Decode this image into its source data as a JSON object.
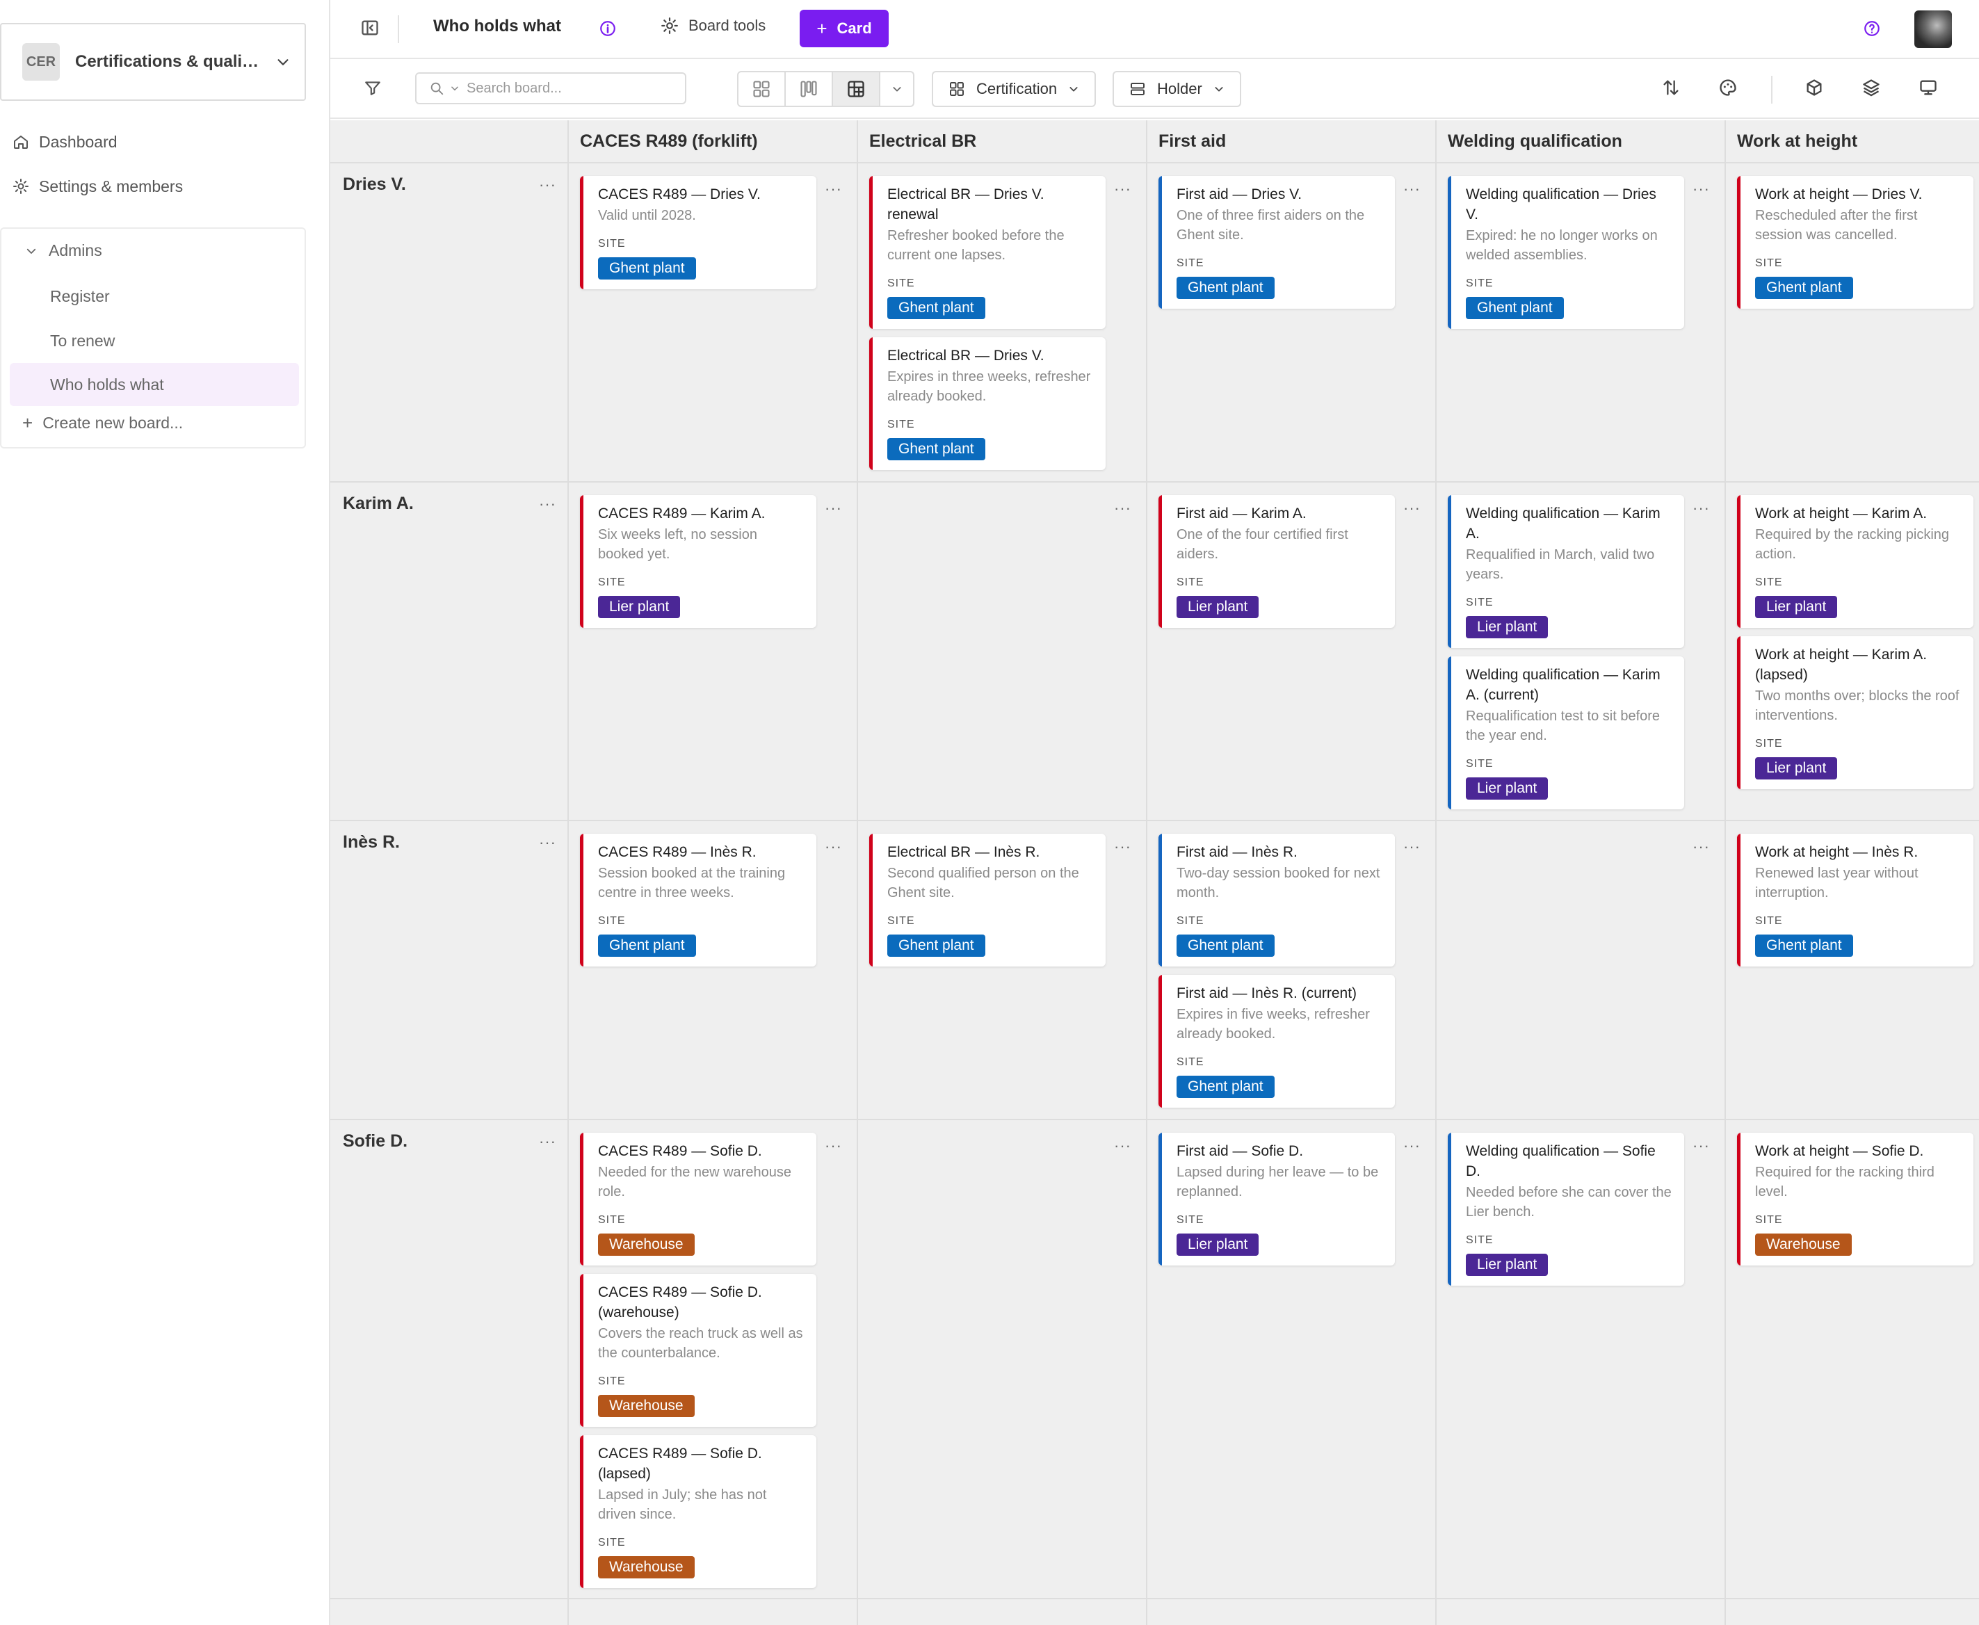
{
  "colors": {
    "red": "#d0021b",
    "blue": "#1565c0",
    "ghent": "#0b6bbd",
    "lier": "#4b2796",
    "warehouse": "#b5561a",
    "primary": "#7a1df0"
  },
  "sidebar": {
    "workspace_badge": "CER",
    "workspace_name": "Certifications & qualifications",
    "dashboard": "Dashboard",
    "settings": "Settings & members",
    "group_label": "Admins",
    "boards": [
      "Register",
      "To renew",
      "Who holds what"
    ],
    "create": "Create new board..."
  },
  "topbar": {
    "title": "Who holds what",
    "tools": "Board tools",
    "card_button": "Card"
  },
  "toolbar": {
    "search_placeholder": "Search board...",
    "group_by": "Certification",
    "row_by": "Holder"
  },
  "board": {
    "columns": [
      "CACES R489 (forklift)",
      "Electrical BR",
      "First aid",
      "Welding qualification",
      "Work at height"
    ],
    "site_label": "SITE",
    "rows": [
      {
        "name": "Dries V.",
        "cells": [
          [
            {
              "title": "CACES R489 — Dries V.",
              "desc": "Valid until 2028.",
              "site": "Ghent plant",
              "accent": "red"
            }
          ],
          [
            {
              "title": "Electrical BR — Dries V. renewal",
              "desc": "Refresher booked before the current one lapses.",
              "site": "Ghent plant",
              "accent": "red"
            },
            {
              "title": "Electrical BR — Dries V.",
              "desc": "Expires in three weeks, refresher already booked.",
              "site": "Ghent plant",
              "accent": "red"
            }
          ],
          [
            {
              "title": "First aid — Dries V.",
              "desc": "One of three first aiders on the Ghent site.",
              "site": "Ghent plant",
              "accent": "blue"
            }
          ],
          [
            {
              "title": "Welding qualification — Dries V.",
              "desc": "Expired: he no longer works on welded assemblies.",
              "site": "Ghent plant",
              "accent": "blue"
            }
          ],
          [
            {
              "title": "Work at height — Dries V.",
              "desc": "Rescheduled after the first session was cancelled.",
              "site": "Ghent plant",
              "accent": "red"
            }
          ]
        ]
      },
      {
        "name": "Karim A.",
        "cells": [
          [
            {
              "title": "CACES R489 — Karim A.",
              "desc": "Six weeks left, no session booked yet.",
              "site": "Lier plant",
              "accent": "red"
            }
          ],
          [],
          [
            {
              "title": "First aid — Karim A.",
              "desc": "One of the four certified first aiders.",
              "site": "Lier plant",
              "accent": "red"
            }
          ],
          [
            {
              "title": "Welding qualification — Karim A.",
              "desc": "Requalified in March, valid two years.",
              "site": "Lier plant",
              "accent": "blue"
            },
            {
              "title": "Welding qualification — Karim A. (current)",
              "desc": "Requalification test to sit before the year end.",
              "site": "Lier plant",
              "accent": "blue"
            }
          ],
          [
            {
              "title": "Work at height — Karim A.",
              "desc": "Required by the racking picking action.",
              "site": "Lier plant",
              "accent": "red"
            },
            {
              "title": "Work at height — Karim A. (lapsed)",
              "desc": "Two months over; blocks the roof interventions.",
              "site": "Lier plant",
              "accent": "red"
            }
          ]
        ]
      },
      {
        "name": "Inès R.",
        "cells": [
          [
            {
              "title": "CACES R489 — Inès R.",
              "desc": "Session booked at the training centre in three weeks.",
              "site": "Ghent plant",
              "accent": "red"
            }
          ],
          [
            {
              "title": "Electrical BR — Inès R.",
              "desc": "Second qualified person on the Ghent site.",
              "site": "Ghent plant",
              "accent": "red"
            }
          ],
          [
            {
              "title": "First aid — Inès R.",
              "desc": "Two-day session booked for next month.",
              "site": "Ghent plant",
              "accent": "blue"
            },
            {
              "title": "First aid — Inès R. (current)",
              "desc": "Expires in five weeks, refresher already booked.",
              "site": "Ghent plant",
              "accent": "red"
            }
          ],
          [],
          [
            {
              "title": "Work at height — Inès R.",
              "desc": "Renewed last year without interruption.",
              "site": "Ghent plant",
              "accent": "red"
            }
          ]
        ]
      },
      {
        "name": "Sofie D.",
        "cells": [
          [
            {
              "title": "CACES R489 — Sofie D.",
              "desc": "Needed for the new warehouse role.",
              "site": "Warehouse",
              "accent": "red"
            },
            {
              "title": "CACES R489 — Sofie D. (warehouse)",
              "desc": "Covers the reach truck as well as the counterbalance.",
              "site": "Warehouse",
              "accent": "red"
            },
            {
              "title": "CACES R489 — Sofie D. (lapsed)",
              "desc": "Lapsed in July; she has not driven since.",
              "site": "Warehouse",
              "accent": "red"
            }
          ],
          [],
          [
            {
              "title": "First aid — Sofie D.",
              "desc": "Lapsed during her leave — to be replanned.",
              "site": "Lier plant",
              "accent": "blue"
            }
          ],
          [
            {
              "title": "Welding qualification — Sofie D.",
              "desc": "Needed before she can cover the Lier bench.",
              "site": "Lier plant",
              "accent": "blue"
            }
          ],
          [
            {
              "title": "Work at height — Sofie D.",
              "desc": "Required for the racking third level.",
              "site": "Warehouse",
              "accent": "red"
            }
          ]
        ]
      }
    ]
  }
}
